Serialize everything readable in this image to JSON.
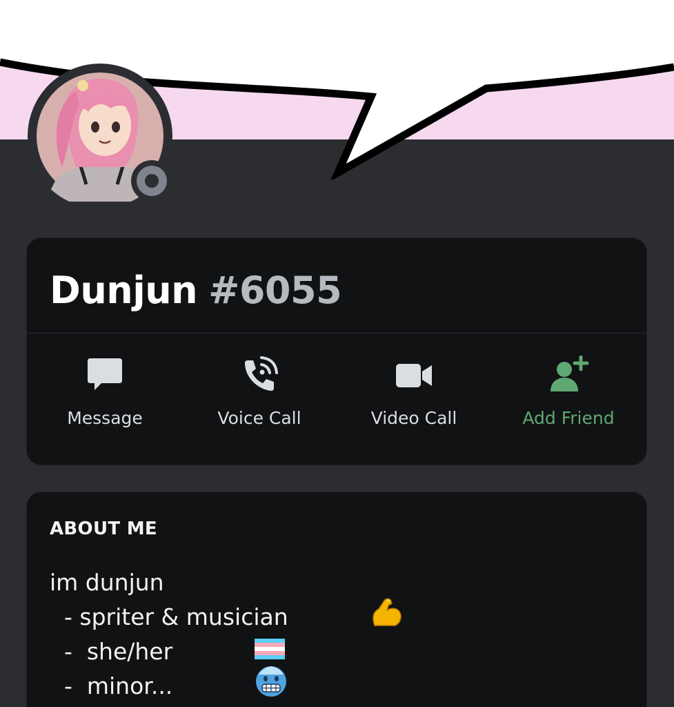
{
  "profile": {
    "username": "Dunjun",
    "discriminator": "#6055",
    "status": "offline"
  },
  "actions": [
    {
      "label": "Message",
      "icon": "chat-bubble-icon"
    },
    {
      "label": "Voice Call",
      "icon": "phone-call-icon"
    },
    {
      "label": "Video Call",
      "icon": "video-camera-icon"
    },
    {
      "label": "Add Friend",
      "icon": "add-friend-icon"
    }
  ],
  "about": {
    "heading": "ABOUT ME",
    "lines": [
      "im dunjun",
      "  - spriter & musician",
      "  -  she/her",
      "  -  minor..."
    ],
    "emojis": [
      "flexed-biceps-emoji",
      "transgender-flag-emoji",
      "cold-face-emoji"
    ]
  },
  "colors": {
    "banner": "#f6d9ef",
    "background": "#2b2d31",
    "card": "#111214",
    "add_friend": "#5fa871",
    "action_icon": "#dbdee1"
  }
}
